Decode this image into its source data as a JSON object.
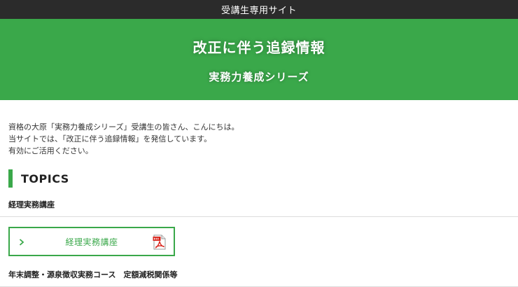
{
  "site": {
    "header_title": "受講生専用サイト"
  },
  "hero": {
    "title": "改正に伴う追録情報",
    "subtitle": "実務力養成シリーズ"
  },
  "intro": {
    "lines": [
      "資格の大原「実務力養成シリーズ」受講生の皆さん、こんにちは。",
      "当サイトでは、「改正に伴う追録情報」を発信しています。",
      "有効にご活用ください。"
    ]
  },
  "topics": {
    "heading": "TOPICS",
    "sections": [
      {
        "label": "経理実務講座",
        "course_button": {
          "label": "経理実務講座",
          "icon": "pdf-icon"
        }
      },
      {
        "label": "年末調整・源泉徴収実務コース　定額減税関係等"
      }
    ]
  },
  "colors": {
    "accent": "#3aa84a",
    "topbar": "#2b2b2b",
    "pdf_red": "#d9251c"
  }
}
